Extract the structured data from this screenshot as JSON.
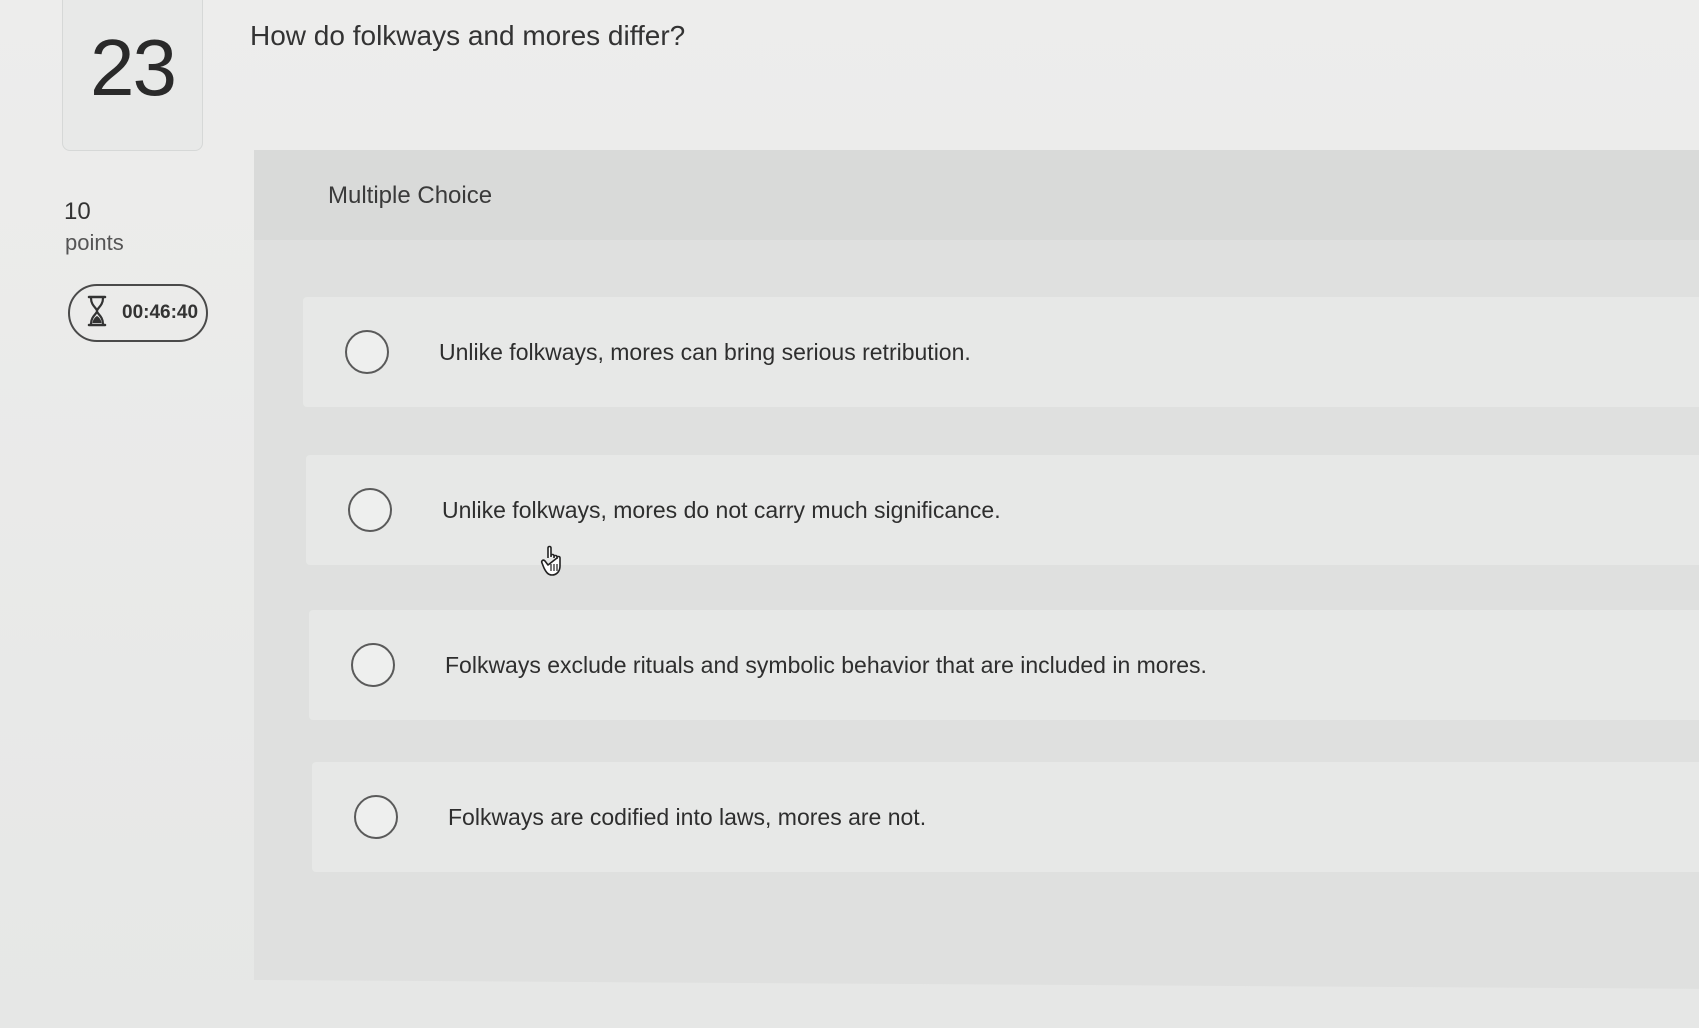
{
  "question": {
    "number": "23",
    "text": "How do folkways and mores differ?",
    "points_value": "10",
    "points_label": "points",
    "timer": "00:46:40",
    "timer_icon": "hourglass-icon",
    "type_label": "Multiple Choice"
  },
  "options": [
    {
      "label": "Unlike folkways, mores can bring serious retribution."
    },
    {
      "label": "Unlike folkways, mores do not carry much significance."
    },
    {
      "label": "Folkways exclude rituals and symbolic behavior that are included in mores."
    },
    {
      "label": "Folkways are codified into laws, mores are not."
    }
  ],
  "cursor_icon": "hand-pointer-icon"
}
